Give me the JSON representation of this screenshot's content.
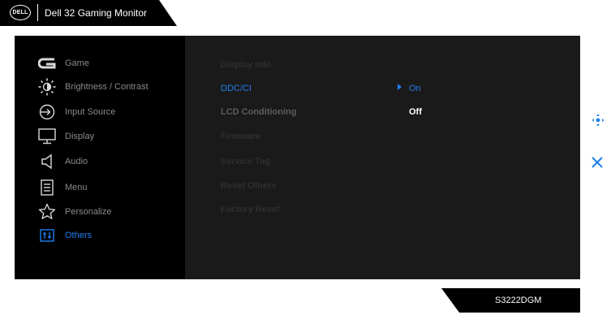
{
  "header": {
    "logo": "DELL",
    "title": "Dell 32 Gaming Monitor"
  },
  "menu": [
    {
      "label": "Game",
      "icon": "game-icon"
    },
    {
      "label": "Brightness / Contrast",
      "icon": "brightness-icon"
    },
    {
      "label": "Input Source",
      "icon": "input-source-icon"
    },
    {
      "label": "Display",
      "icon": "display-icon"
    },
    {
      "label": "Audio",
      "icon": "audio-icon"
    },
    {
      "label": "Menu",
      "icon": "menu-icon"
    },
    {
      "label": "Personalize",
      "icon": "star-icon"
    },
    {
      "label": "Others",
      "icon": "others-icon",
      "active": true
    }
  ],
  "submenu": [
    {
      "label": "Display Info"
    },
    {
      "label": "DDC/CI",
      "selected": true
    },
    {
      "label": "LCD Conditioning",
      "bright": true
    },
    {
      "label": "Firmware"
    },
    {
      "label": "Service Tag"
    },
    {
      "label": "Reset Others"
    },
    {
      "label": "Factory Reset"
    }
  ],
  "options": {
    "on": "On",
    "off": "Off",
    "current": "On"
  },
  "side_controls": {
    "navigate": "joystick-icon",
    "close": "close-icon"
  },
  "footer": {
    "model": "S3222DGM"
  },
  "colors": {
    "accent": "#1e7ff0",
    "panel": "#000000",
    "submenu_bg": "#1a1a1a"
  }
}
